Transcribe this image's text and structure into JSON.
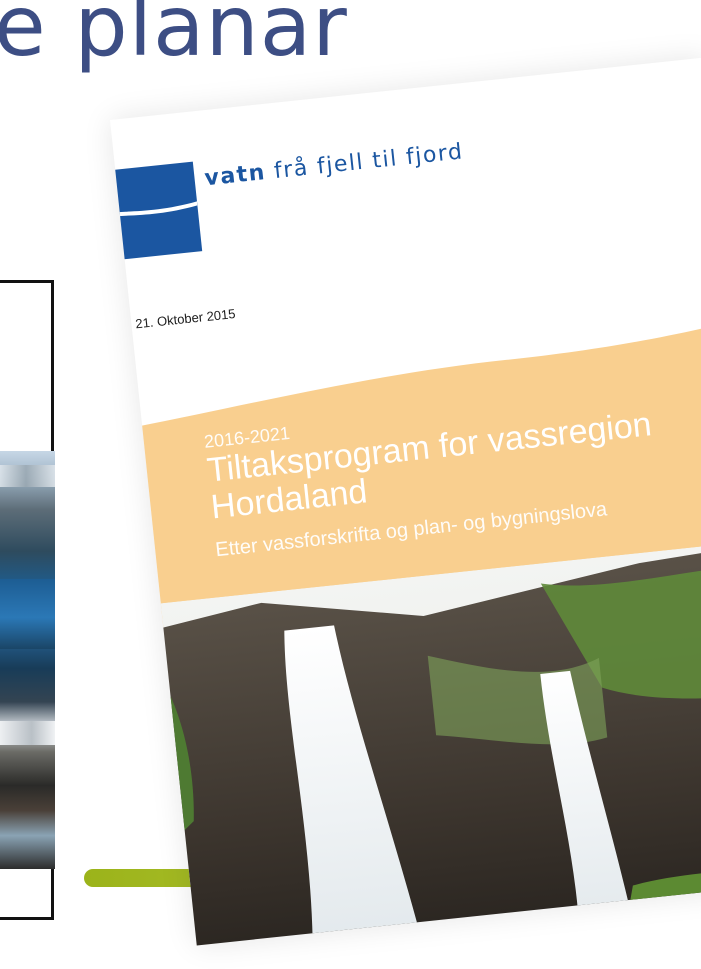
{
  "slide": {
    "title": "e planar"
  },
  "cover": {
    "logo_bold": "vatn",
    "logo_rest": " frå fjell til fjord",
    "date": "21. Oktober 2015",
    "years": "2016-2021",
    "title_line1": "Tiltaksprogram for vassregion",
    "title_line2": "Hordaland",
    "subtitle": "Etter vassforskrifta og plan- og bygningslova"
  },
  "colors": {
    "title": "#3d4e84",
    "logo_blue": "#1b56a1",
    "band_orange": "#f9cf8f",
    "accent_green": "#a7bf27"
  }
}
